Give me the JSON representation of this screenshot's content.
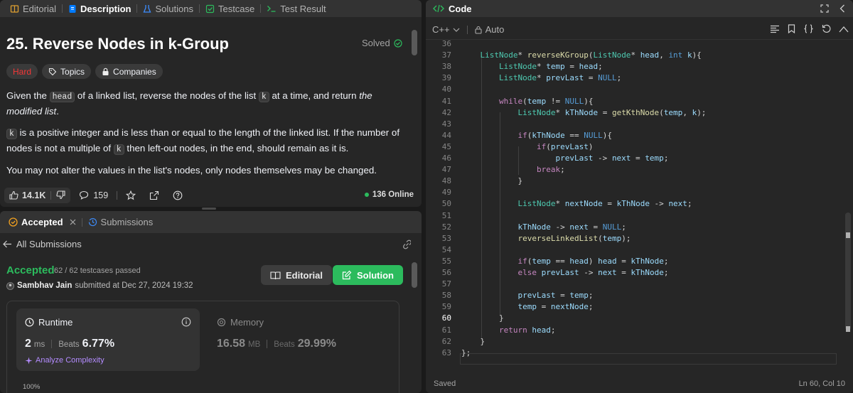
{
  "left_tabs": [
    {
      "label": "Editorial"
    },
    {
      "label": "Description"
    },
    {
      "label": "Solutions"
    },
    {
      "label": "Testcase"
    },
    {
      "label": "Test Result"
    }
  ],
  "problem": {
    "title": "25. Reverse Nodes in k-Group",
    "solved_label": "Solved",
    "difficulty": "Hard",
    "topics_label": "Topics",
    "companies_label": "Companies",
    "p1_a": "Given the ",
    "p1_code1": "head",
    "p1_b": " of a linked list, reverse the nodes of the list ",
    "p1_code2": "k",
    "p1_c": " at a time, and return ",
    "p1_em": "the modified list",
    "p1_d": ".",
    "p2_code1": "k",
    "p2_a": " is a positive integer and is less than or equal to the length of the linked list. If the number of nodes is not a multiple of ",
    "p2_code2": "k",
    "p2_b": " then left-out nodes, in the end, should remain as it is.",
    "p3": "You may not alter the values in the list's nodes, only nodes themselves may be changed."
  },
  "footer": {
    "likes": "14.1K",
    "comments": "159",
    "online": "136 Online"
  },
  "submission_tabs": {
    "accepted": "Accepted",
    "submissions": "Submissions"
  },
  "submission": {
    "back_label": "All Submissions",
    "status": "Accepted",
    "testcases": "62 / 62 testcases passed",
    "user": "Sambhav Jain",
    "submitted_text": "submitted at Dec 27, 2024 19:32",
    "editorial_button": "Editorial",
    "solution_button": "Solution",
    "runtime_label": "Runtime",
    "runtime_value": "2",
    "runtime_unit": "ms",
    "runtime_beats_label": "Beats",
    "runtime_beats": "6.77%",
    "analyze_label": "Analyze Complexity",
    "memory_label": "Memory",
    "memory_value": "16.58",
    "memory_unit": "MB",
    "memory_beats_label": "Beats",
    "memory_beats": "29.99%",
    "axis_100": "100%"
  },
  "code_panel": {
    "title": "Code",
    "language": "C++",
    "mode": "Auto",
    "saved_label": "Saved",
    "cursor_position": "Ln 60, Col 10"
  },
  "code_lines": [
    {
      "num": "36",
      "html": ""
    },
    {
      "num": "37",
      "html": "    <span class='t'>ListNode</span>* <span class='f'>reverseKGroup</span>(<span class='t'>ListNode</span>* <span class='v'>head</span>, <span class='k'>int</span> <span class='v'>k</span>){"
    },
    {
      "num": "38",
      "html": "        <span class='t'>ListNode</span>* <span class='v'>temp</span> = <span class='v'>head</span>;"
    },
    {
      "num": "39",
      "html": "        <span class='t'>ListNode</span>* <span class='v'>prevLast</span> = <span class='k'>NULL</span>;"
    },
    {
      "num": "40",
      "html": ""
    },
    {
      "num": "41",
      "html": "        <span class='cf'>while</span>(<span class='v'>temp</span> != <span class='k'>NULL</span>){"
    },
    {
      "num": "42",
      "html": "            <span class='t'>ListNode</span>* <span class='v'>kThNode</span> = <span class='f'>getKthNode</span>(<span class='v'>temp</span>, <span class='v'>k</span>);"
    },
    {
      "num": "43",
      "html": ""
    },
    {
      "num": "44",
      "html": "            <span class='cf'>if</span>(<span class='v'>kThNode</span> == <span class='k'>NULL</span>){"
    },
    {
      "num": "45",
      "html": "                <span class='cf'>if</span>(<span class='v'>prevLast</span>)"
    },
    {
      "num": "46",
      "html": "                    <span class='v'>prevLast</span> -&gt; <span class='v'>next</span> = <span class='v'>temp</span>;"
    },
    {
      "num": "47",
      "html": "                <span class='cf'>break</span>;"
    },
    {
      "num": "48",
      "html": "            }"
    },
    {
      "num": "49",
      "html": ""
    },
    {
      "num": "50",
      "html": "            <span class='t'>ListNode</span>* <span class='v'>nextNode</span> = <span class='v'>kThNode</span> -&gt; <span class='v'>next</span>;"
    },
    {
      "num": "51",
      "html": ""
    },
    {
      "num": "52",
      "html": "            <span class='v'>kThNode</span> -&gt; <span class='v'>next</span> = <span class='k'>NULL</span>;"
    },
    {
      "num": "53",
      "html": "            <span class='f'>reverseLinkedList</span>(<span class='v'>temp</span>);"
    },
    {
      "num": "54",
      "html": ""
    },
    {
      "num": "55",
      "html": "            <span class='cf'>if</span>(<span class='v'>temp</span> == <span class='v'>head</span>) <span class='v'>head</span> = <span class='v'>kThNode</span>;"
    },
    {
      "num": "56",
      "html": "            <span class='cf'>else</span> <span class='v'>prevLast</span> -&gt; <span class='v'>next</span> = <span class='v'>kThNode</span>;"
    },
    {
      "num": "57",
      "html": ""
    },
    {
      "num": "58",
      "html": "            <span class='v'>prevLast</span> = <span class='v'>temp</span>;"
    },
    {
      "num": "59",
      "html": "            <span class='v'>temp</span> = <span class='v'>nextNode</span>;"
    },
    {
      "num": "60",
      "html": "        }"
    },
    {
      "num": "61",
      "html": "        <span class='cf'>return</span> <span class='v'>head</span>;"
    },
    {
      "num": "62",
      "html": "    }"
    },
    {
      "num": "63",
      "html": "};"
    }
  ],
  "colors": {
    "accepted": "#2cbb5d",
    "hard": "#f63737",
    "analyze": "#b48cff",
    "tab_accent": "#007aff"
  }
}
